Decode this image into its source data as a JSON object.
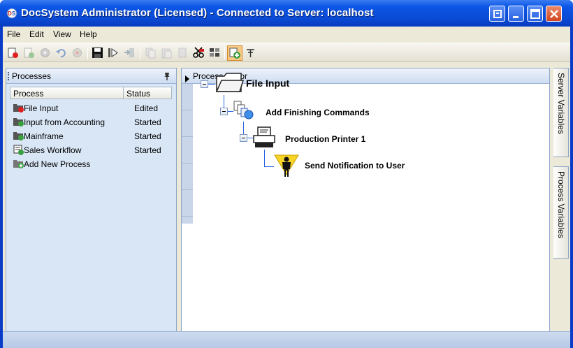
{
  "window": {
    "title": "DocSystem Administrator (Licensed) - Connected to Server: localhost"
  },
  "menu": [
    "File",
    "Edit",
    "View",
    "Help"
  ],
  "toolbar": {
    "icons": [
      "stop-process-icon",
      "start-process-icon",
      "settings-icon",
      "undo-icon",
      "refresh-icon",
      "save-icon",
      "deploy-icon",
      "export-icon",
      "copy-icon",
      "paste-icon",
      "duplicate-icon",
      "cut-icon",
      "properties-icon",
      "add-step-icon",
      "pin-icon"
    ]
  },
  "processes_panel": {
    "title": "Processes",
    "columns": [
      "Process",
      "Status"
    ],
    "rows": [
      {
        "name": "File Input",
        "status": "Edited",
        "icon": "process-edited-icon"
      },
      {
        "name": "Input from Accounting",
        "status": "Started",
        "icon": "process-started-icon"
      },
      {
        "name": "Mainframe",
        "status": "Started",
        "icon": "process-started-icon"
      },
      {
        "name": "Sales Workflow",
        "status": "Started",
        "icon": "workflow-icon"
      },
      {
        "name": "Add New Process",
        "status": "",
        "icon": "add-process-icon"
      }
    ]
  },
  "editor": {
    "title": "Process Editor",
    "nodes": [
      {
        "label": "File Input",
        "icon": "folder-icon"
      },
      {
        "label": "Add Finishing Commands",
        "icon": "finishing-commands-icon"
      },
      {
        "label": "Production Printer 1",
        "icon": "printer-icon"
      },
      {
        "label": "Send Notification to User",
        "icon": "notification-user-icon"
      }
    ]
  },
  "side_tabs": [
    "Server Variables",
    "Process Variables"
  ]
}
